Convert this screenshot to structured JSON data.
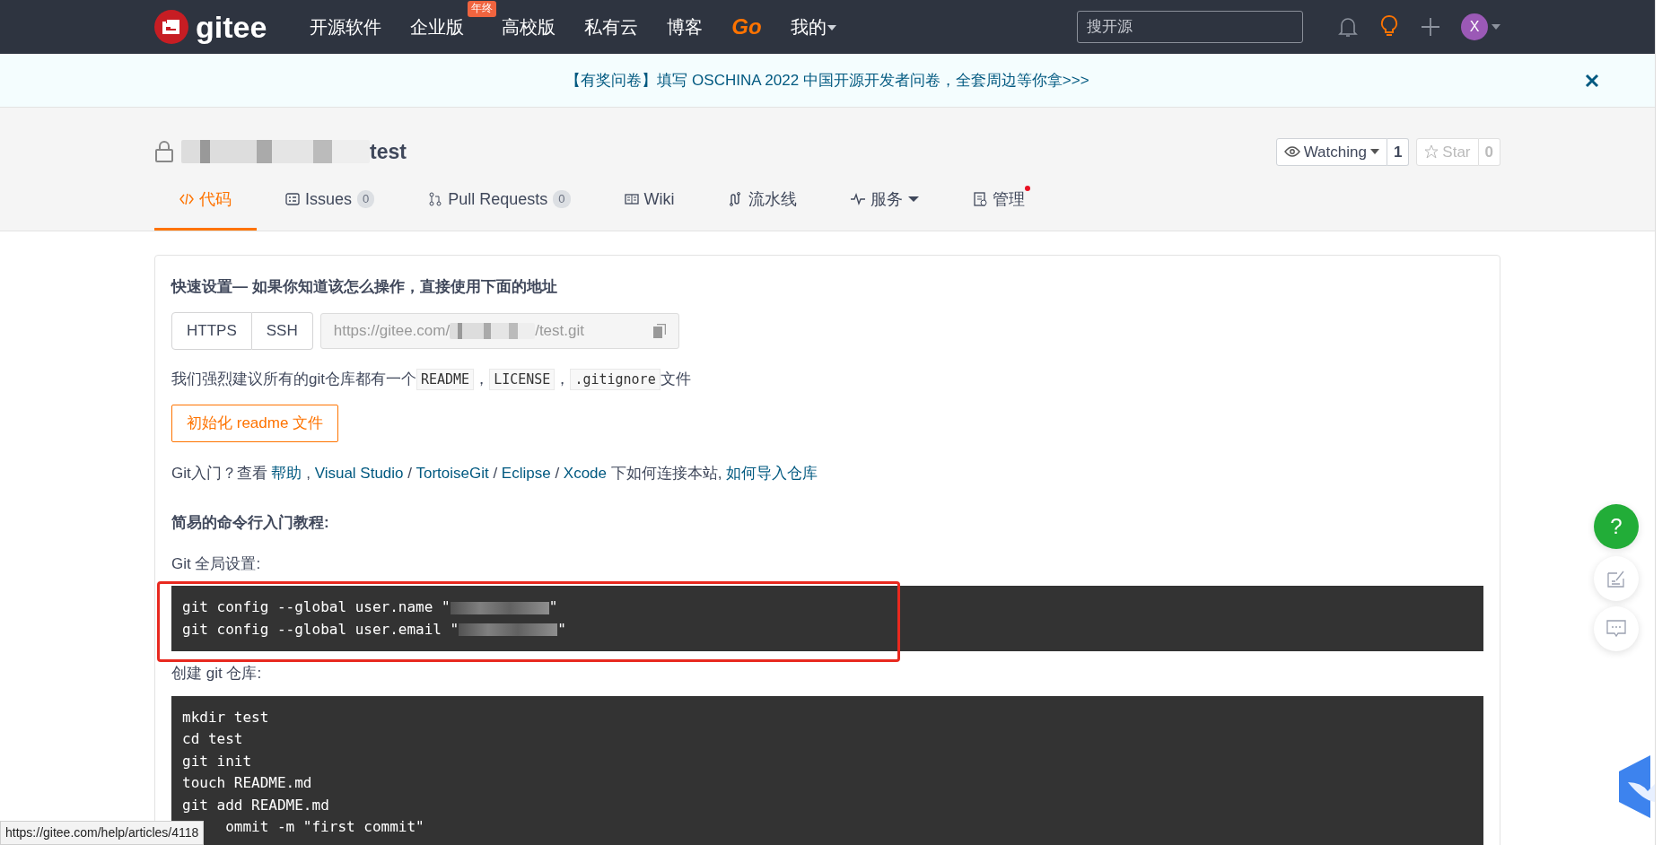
{
  "navbar": {
    "logo": "gitee",
    "items": [
      {
        "label": "开源软件",
        "kind": "plain"
      },
      {
        "label": "企业版",
        "kind": "plain",
        "badge": "年终"
      },
      {
        "label": "高校版",
        "kind": "plain"
      },
      {
        "label": "私有云",
        "kind": "plain"
      },
      {
        "label": "博客",
        "kind": "plain"
      },
      {
        "label": "Go",
        "kind": "brand"
      },
      {
        "label": "我的",
        "kind": "dropdown"
      }
    ],
    "search": {
      "placeholder": "搜开源"
    },
    "avatar": "X"
  },
  "banner": {
    "text": "【有奖问卷】填写 OSCHINA 2022 中国开源开发者问卷，全套周边等你拿>>>"
  },
  "repo": {
    "name": "test",
    "private": true,
    "watch": {
      "label": "Watching",
      "count": "1"
    },
    "star": {
      "label": "Star",
      "count": "0",
      "disabled": true
    }
  },
  "tabs": [
    {
      "label": "代码",
      "selected": true
    },
    {
      "label": "Issues",
      "count": "0",
      "selected": false
    },
    {
      "label": "Pull Requests",
      "count": "0",
      "selected": false
    },
    {
      "label": "Wiki",
      "selected": false
    },
    {
      "label": "流水线",
      "selected": false
    },
    {
      "label": "服务",
      "dropdown": true,
      "selected": false
    },
    {
      "label": "管理",
      "dot": true,
      "selected": false
    }
  ],
  "quick_setup": {
    "title": "快速设置— 如果你知道该怎么操作，直接使用下面的地址",
    "protocols": [
      "HTTPS",
      "SSH"
    ],
    "url": {
      "prefix": "https://gitee.com/",
      "suffix": "/test.git"
    },
    "recommend": [
      {
        "kind": "text",
        "text": "我们强烈建议所有的git仓库都有一个"
      },
      {
        "kind": "code",
        "text": "README"
      },
      {
        "kind": "text",
        "text": "，"
      },
      {
        "kind": "code",
        "text": "LICENSE"
      },
      {
        "kind": "text",
        "text": "，"
      },
      {
        "kind": "code",
        "text": ".gitignore"
      },
      {
        "kind": "text",
        "text": "文件"
      }
    ],
    "init_button": "初始化 readme 文件",
    "help": [
      {
        "kind": "text",
        "text": "Git入门？查看 "
      },
      {
        "kind": "link",
        "text": "帮助"
      },
      {
        "kind": "text",
        "text": " , "
      },
      {
        "kind": "link",
        "text": "Visual Studio"
      },
      {
        "kind": "text",
        "text": " / "
      },
      {
        "kind": "link",
        "text": "TortoiseGit"
      },
      {
        "kind": "text",
        "text": " / "
      },
      {
        "kind": "link",
        "text": "Eclipse"
      },
      {
        "kind": "text",
        "text": " / "
      },
      {
        "kind": "link",
        "text": "Xcode"
      },
      {
        "kind": "text",
        "text": " 下如何连接本站, "
      },
      {
        "kind": "link",
        "text": "如何导入仓库"
      }
    ]
  },
  "tutorial": {
    "title": "简易的命令行入门教程:",
    "blocks": [
      {
        "label": "Git 全局设置:",
        "highlighted": true,
        "lines": [
          {
            "text": "git config --global user.name \"",
            "redacted": true,
            "after": "\""
          },
          {
            "text": "git config --global user.email \"",
            "redacted": true,
            "after": "\""
          }
        ]
      },
      {
        "label": "创建 git 仓库:",
        "highlighted": false,
        "lines": [
          {
            "text": "mkdir test",
            "redacted": false
          },
          {
            "text": "cd test",
            "redacted": false
          },
          {
            "text": "git init",
            "redacted": false
          },
          {
            "text": "touch README.md",
            "redacted": false
          },
          {
            "text": "git add README.md",
            "redacted": false
          },
          {
            "text": "ommit -m \"first commit\"",
            "redacted": false,
            "cut_start": true
          }
        ]
      }
    ]
  },
  "float_buttons": {
    "help": "?"
  },
  "status_bar": "https://gitee.com/help/articles/4118"
}
